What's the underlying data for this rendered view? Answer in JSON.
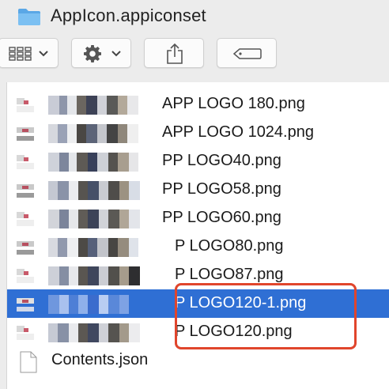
{
  "window": {
    "title": "AppIcon.appiconset"
  },
  "toolbar": {
    "view_icon": "grid-icon",
    "action_icon": "gear-icon",
    "share_icon": "share-icon",
    "tag_icon": "tag-icon"
  },
  "files": [
    {
      "name": "APP LOGO 180.png",
      "selected": false
    },
    {
      "name": "APP LOGO 1024.png",
      "selected": false
    },
    {
      "name": "PP LOGO40.png",
      "selected": false
    },
    {
      "name": "PP LOGO58.png",
      "selected": false
    },
    {
      "name": "PP LOGO60.png",
      "selected": false
    },
    {
      "name": "P LOGO80.png",
      "selected": false
    },
    {
      "name": "P LOGO87.png",
      "selected": false
    },
    {
      "name": "P LOGO120-1.png",
      "selected": true
    },
    {
      "name": "P LOGO120.png",
      "selected": false
    }
  ],
  "contents_file": {
    "name": "Contents.json"
  },
  "colors": {
    "selection": "#2f6fd4",
    "annotation": "#e0452c",
    "folder": "#5aa7e6"
  }
}
